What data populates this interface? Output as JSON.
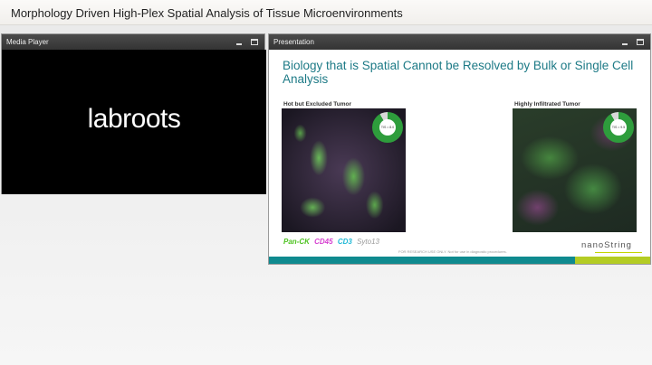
{
  "page": {
    "title": "Morphology Driven High-Plex Spatial Analysis of Tissue Microenvironments"
  },
  "media_player": {
    "title": "Media Player",
    "logo_text": "labroots"
  },
  "presentation": {
    "title": "Presentation",
    "slide": {
      "heading": "Biology that is Spatial Cannot be Resolved by Bulk or Single Cell Analysis",
      "left_caption": "Hot but Excluded Tumor",
      "right_caption": "Highly Infiltrated Tumor",
      "left_donut_text": "TIS = 8.0",
      "right_donut_text": "TIS = 9.5",
      "legend": [
        {
          "label": "Pan-CK",
          "color": "#4cc21f"
        },
        {
          "label": "CD45",
          "color": "#d63fd0"
        },
        {
          "label": "CD3",
          "color": "#1fb8d6"
        },
        {
          "label": "Syto13",
          "color": "#9a9a9a"
        }
      ],
      "disclaimer": "FOR RESEARCH USE ONLY. Not for use in diagnostic procedures.",
      "brand": "nanoString"
    }
  },
  "controls": {
    "minimize_icon": "minimize-icon",
    "maximize_icon": "maximize-icon"
  }
}
